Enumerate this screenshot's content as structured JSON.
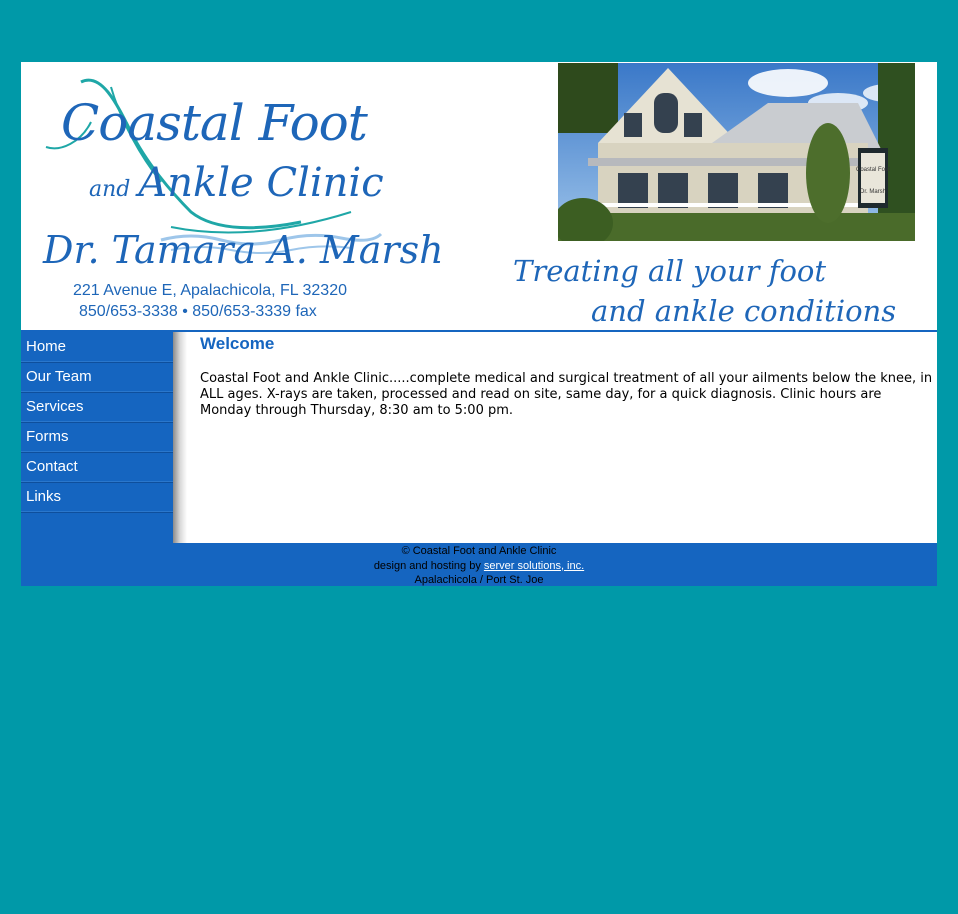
{
  "logo": {
    "title_line1": "Coastal Foot",
    "title_and": "and",
    "title_line2": "Ankle Clinic",
    "doctor": "Dr. Tamara A. Marsh",
    "address": "221 Avenue E, Apalachicola, FL 32320",
    "phones": "850/653-3338 • 850/653-3339 fax"
  },
  "tagline": {
    "line1": "Treating all your foot",
    "line2": "and ankle conditions"
  },
  "photo": {
    "sign_line1": "Coastal Foot",
    "sign_line2": "Dr. Marsh"
  },
  "nav": [
    {
      "label": "Home"
    },
    {
      "label": "Our Team"
    },
    {
      "label": "Services"
    },
    {
      "label": "Forms"
    },
    {
      "label": "Contact"
    },
    {
      "label": "Links"
    }
  ],
  "content": {
    "title": "Welcome",
    "body": "Coastal Foot and Ankle Clinic.....complete medical and surgical treatment of all your ailments below the knee, in ALL ages. X-rays are taken, processed and read on site, same day, for a quick diagnosis. Clinic hours are Monday through Thursday, 8:30 am to 5:00 pm."
  },
  "footer": {
    "copyright": "© Coastal Foot and Ankle Clinic",
    "design_prefix": "design and hosting by",
    "design_link": "server solutions, inc.",
    "locations": "Apalachicola / Port St. Joe"
  },
  "colors": {
    "background": "#0099a8",
    "brand_blue": "#1565c0",
    "logo_blue": "#1e66b8",
    "accent_teal": "#1fa7a7"
  }
}
